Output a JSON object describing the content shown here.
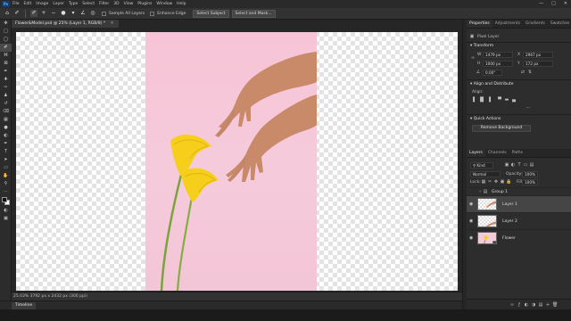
{
  "menu": [
    "File",
    "Edit",
    "Image",
    "Layer",
    "Type",
    "Select",
    "Filter",
    "3D",
    "View",
    "Plugins",
    "Window",
    "Help"
  ],
  "window_controls": [
    "minimize",
    "maximize",
    "close"
  ],
  "options": {
    "sample_all_layers": "Sample All Layers",
    "enhance_edge": "Enhance Edge",
    "select_subject": "Select Subject",
    "select_and_mask": "Select and Mask..."
  },
  "document": {
    "tab_title": "Flower&Model.psd @ 25% (Layer 1, RGB/8) *",
    "status": "25.03%  3792 px x 2432 px (300 ppi)"
  },
  "timeline": {
    "label": "Timeline"
  },
  "properties_panel": {
    "tabs": [
      "Properties",
      "Adjustments",
      "Gradients",
      "Swatches"
    ],
    "layer_kind": "Pixel Layer",
    "transform": {
      "title": "Transform",
      "w_label": "W",
      "w_value": "1479 px",
      "x_label": "X",
      "x_value": "2967 px",
      "h_label": "H",
      "h_value": "1000 px",
      "y_label": "Y",
      "y_value": "172 px",
      "angle_value": "0.00°"
    },
    "align": {
      "title": "Align and Distribute",
      "align_label": "Align:"
    },
    "quick_actions": {
      "title": "Quick Actions",
      "remove_background": "Remove Background"
    }
  },
  "layers_panel": {
    "tabs": [
      "Layers",
      "Channels",
      "Paths"
    ],
    "kind_filter": "Kind",
    "blend_mode": "Normal",
    "opacity_label": "Opacity:",
    "opacity_value": "100%",
    "lock_label": "Lock:",
    "fill_label": "Fill:",
    "fill_value": "100%",
    "layers": [
      {
        "name": "Group 1",
        "type": "group",
        "visible": false,
        "selected": false
      },
      {
        "name": "Layer 1",
        "type": "pixel",
        "visible": true,
        "selected": true
      },
      {
        "name": "Layer 2",
        "type": "pixel",
        "visible": true,
        "selected": false
      },
      {
        "name": "Flower",
        "type": "smart",
        "visible": true,
        "selected": false
      }
    ]
  },
  "colors": {
    "accent": "#5db0ff",
    "canvas_bg": "#f5cbdb",
    "flower": "#f6cf1c",
    "stem": "#7aa33b"
  }
}
